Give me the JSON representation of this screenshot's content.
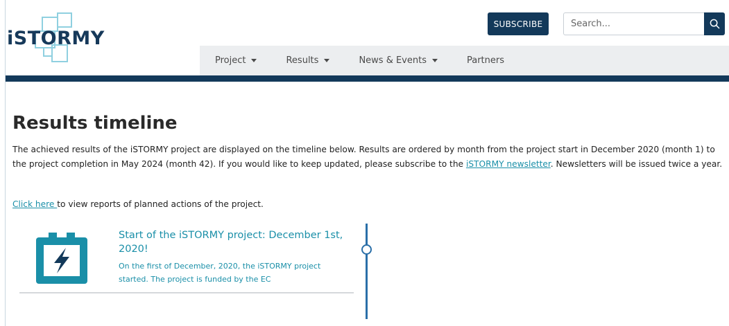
{
  "header": {
    "logo_text": "iSTORMY",
    "subscribe_label": "SUBSCRIBE",
    "search_placeholder": "Search...",
    "nav": [
      {
        "label": "Project",
        "dropdown": true
      },
      {
        "label": "Results",
        "dropdown": true
      },
      {
        "label": "News & Events",
        "dropdown": true
      },
      {
        "label": "Partners",
        "dropdown": false
      }
    ]
  },
  "main": {
    "title": "Results timeline",
    "intro_before_link": "The achieved results of the iSTORMY project are displayed on the timeline below. Results are ordered by month from the project start in December 2020 (month 1) to the project completion in May 2024 (month 42). If you would like to keep updated, please subscribe to the ",
    "intro_link": "iSTORMY newsletter",
    "intro_after_link": ". Newsletters will be issued twice a year.",
    "planned_link": "Click here ",
    "planned_text": "to view reports of planned actions of the project."
  },
  "timeline": {
    "items": [
      {
        "icon": "battery-bolt-icon",
        "title": "Start of the iSTORMY project: December 1st, 2020!",
        "text": "On the first of December, 2020, the iSTORMY project started. The project is funded by the EC"
      }
    ]
  },
  "colors": {
    "brand_navy": "#13395a",
    "accent_teal": "#1a8fa8",
    "timeline_blue": "#2a6fa8"
  }
}
